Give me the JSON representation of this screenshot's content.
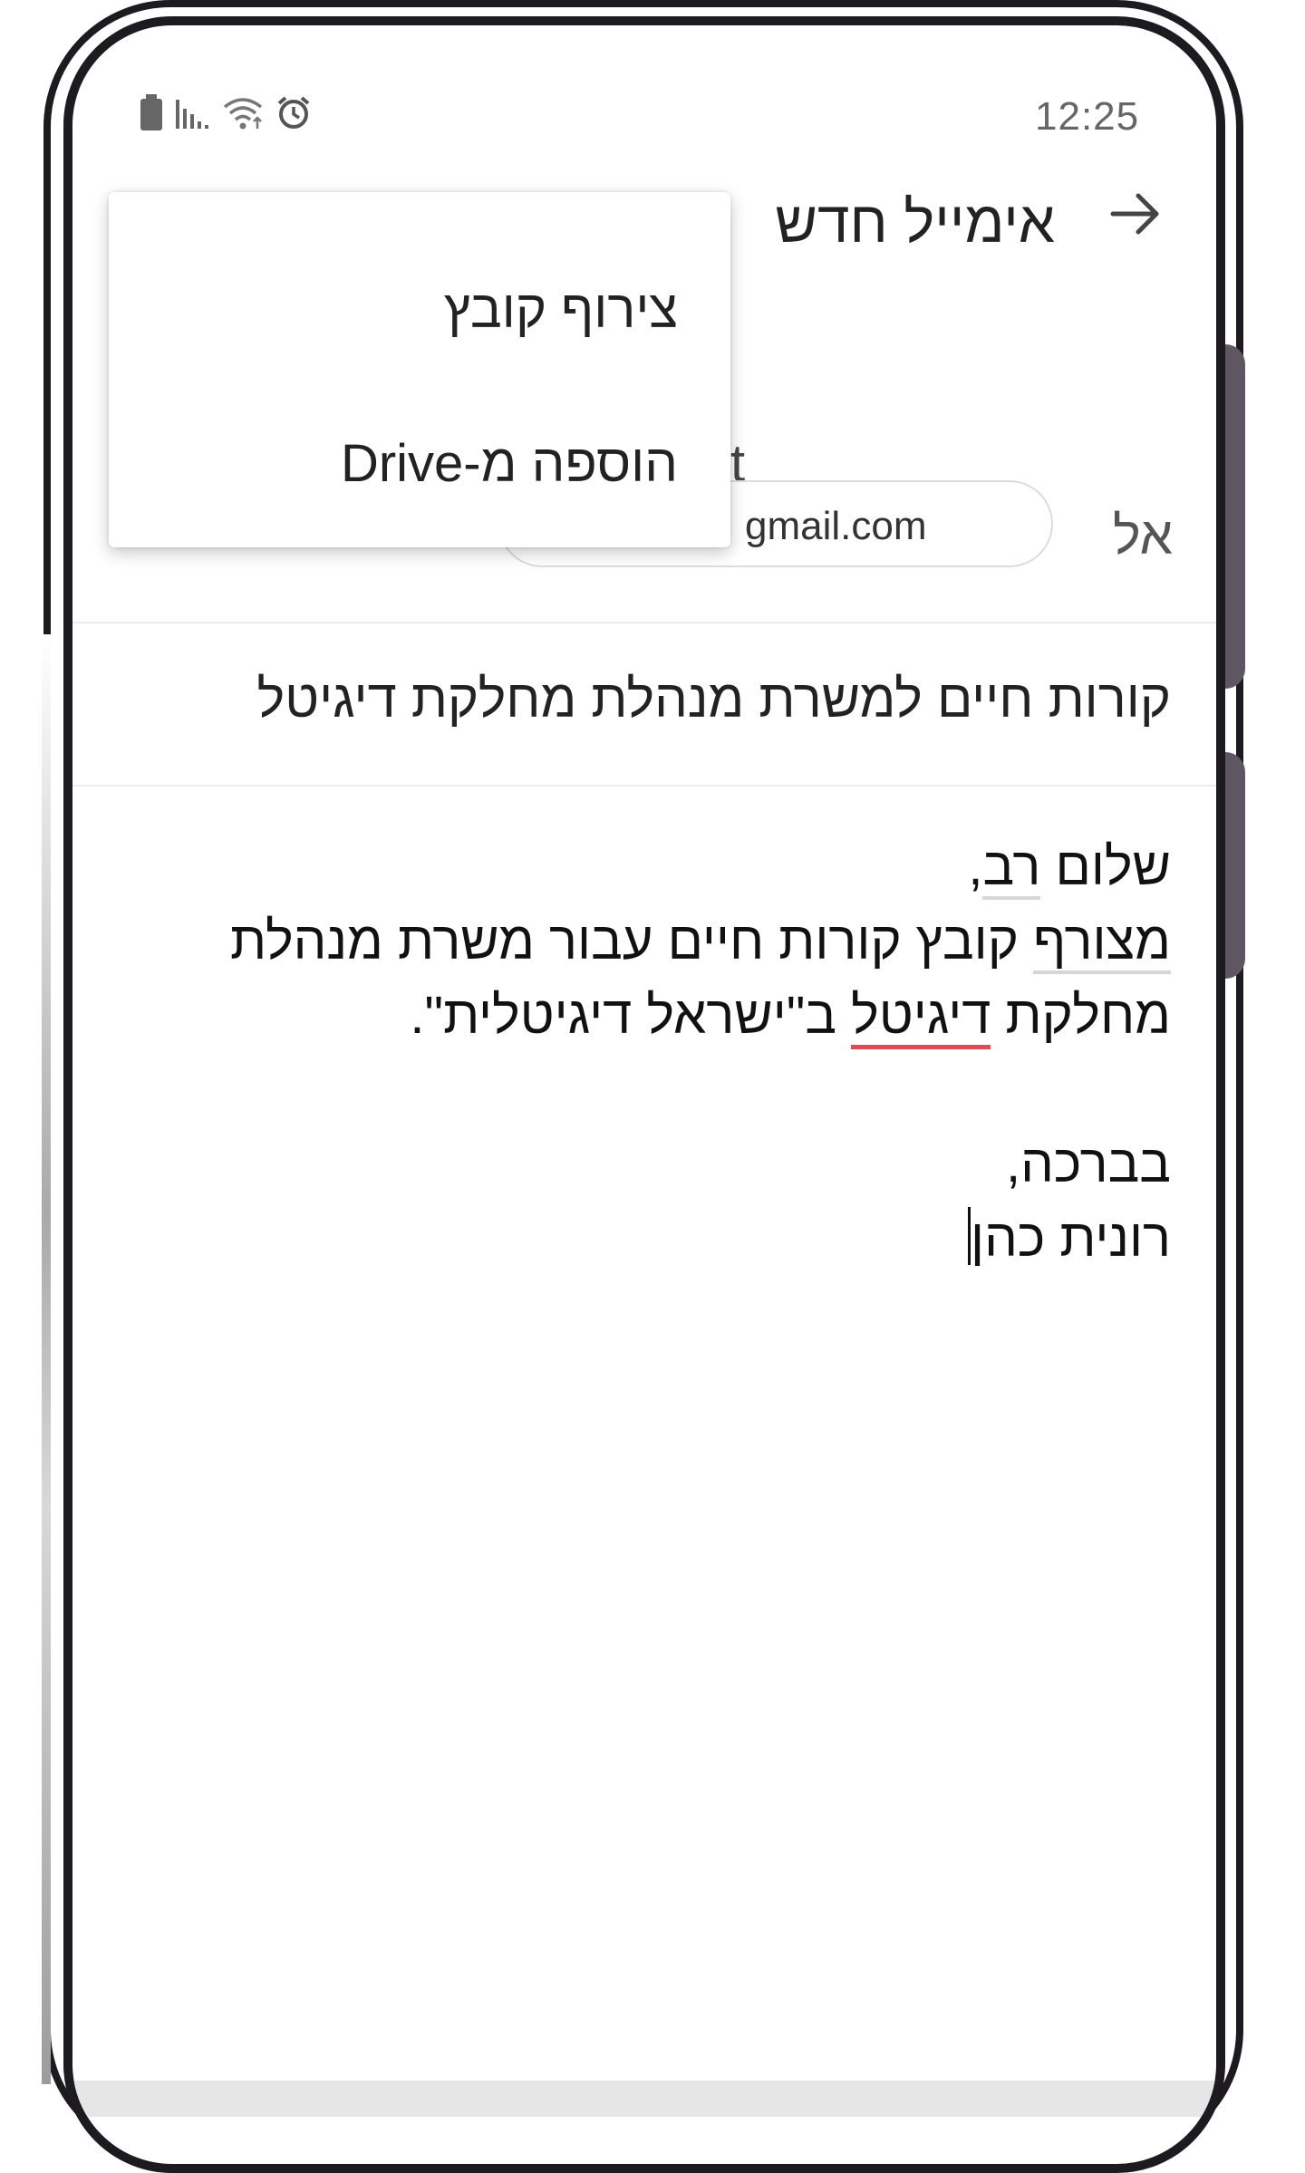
{
  "status_bar": {
    "time": "12:25",
    "icons": [
      "battery-icon",
      "signal-icon",
      "wifi-icon",
      "alarm-icon"
    ]
  },
  "app_bar": {
    "title": "אימייל חדש",
    "back_icon": "arrow-right-icon"
  },
  "overflow_menu": {
    "items": [
      {
        "label": "צירוף קובץ"
      },
      {
        "label": "הוספה מ-Drive"
      }
    ]
  },
  "recipients": {
    "to_label": "אל",
    "chip_text": "gmail.com",
    "partial_letter": "t"
  },
  "subject": "קורות חיים למשרת מנהלת מחלקת דיגיטל",
  "body": {
    "greeting_pre": "שלום ",
    "greeting_word": "רב",
    "greeting_post": ",",
    "line2_word": "מצורף",
    "line2_rest": " קובץ קורות חיים עבור משרת מנהלת",
    "line3_pre": "מחלקת ",
    "line3_word": "דיגיטל",
    "line3_post": " ב\"ישראל דיגיטלית\".",
    "closing": "בברכה,",
    "signature": "רונית כהן"
  },
  "colors": {
    "text": "#222222",
    "spell_underline": "#e24a57",
    "frame": "#1d1b20"
  }
}
